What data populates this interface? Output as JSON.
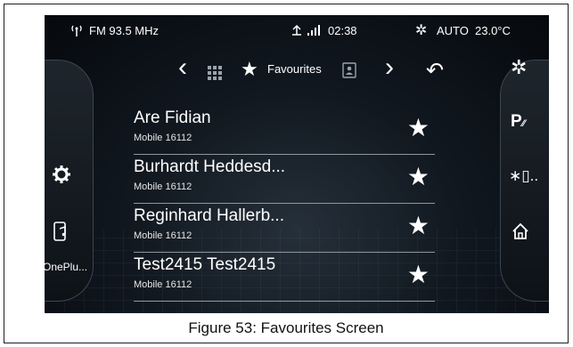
{
  "status_bar": {
    "radio_icon": "radio-antenna-icon",
    "radio_label": "FM 93.5 MHz",
    "signal_icon": "phone-signal-icon",
    "time": "02:38",
    "climate_icon": "climate-fan-icon",
    "climate_mode": "AUTO",
    "temperature": "23.0°C"
  },
  "nav": {
    "prev_arrow": "‹",
    "grid_icon": "grid-icon",
    "star_icon": "★",
    "title": "Favourites",
    "contacts_icon": "contacts-book-icon",
    "next_arrow": "›",
    "back_icon": "↶"
  },
  "left_sidebar": {
    "settings_icon": "gear-icon",
    "phone_music_icon": "phone-music-icon",
    "device_label": "OnePlu..."
  },
  "right_sidebar": {
    "climate_icon": "climate-fan-icon",
    "park_assist_label": "P",
    "bluetooth_icon": "bluetooth-phone-icon",
    "home_icon": "home-icon"
  },
  "favourites": [
    {
      "name": "Are Fidian",
      "number": "Mobile  16112"
    },
    {
      "name": "Burhardt Heddesd...",
      "number": "Mobile  16112"
    },
    {
      "name": "Reginhard Hallerb...",
      "number": "Mobile  16112"
    },
    {
      "name": "Test2415 Test2415",
      "number": "Mobile  16112"
    }
  ],
  "caption": "Figure 53: Favourites Screen",
  "colors": {
    "screen_bg": "#0b1116",
    "text": "#ffffff",
    "divider": "#8f979e"
  }
}
